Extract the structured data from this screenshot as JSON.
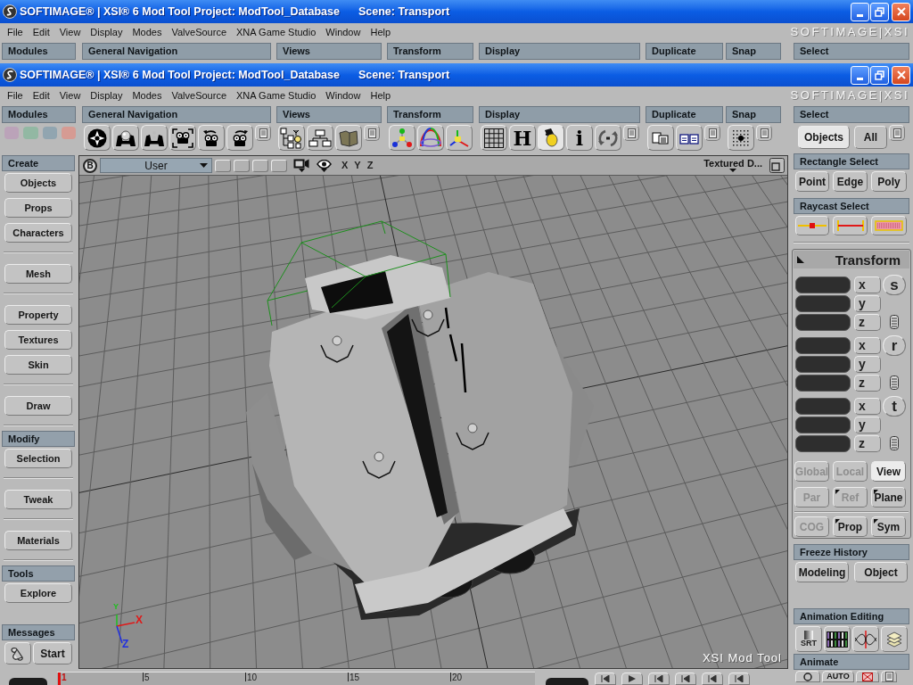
{
  "back_window": {
    "title": "SOFTIMAGE® | XSI® 6 Mod Tool Project: ModTool_Database",
    "scene": "Scene: Transport",
    "menu": [
      "File",
      "Edit",
      "View",
      "Display",
      "Modes",
      "ValveSource",
      "XNA Game Studio",
      "Window",
      "Help"
    ],
    "logo": "SOFTIMAGE|XSI",
    "toolbar_headers": [
      "Modules",
      "General Navigation",
      "Views",
      "Transform",
      "Display",
      "Duplicate",
      "Snap",
      "Select"
    ]
  },
  "window": {
    "title": "SOFTIMAGE® | XSI® 6 Mod Tool Project: ModTool_Database",
    "scene": "Scene: Transport",
    "menu": [
      "File",
      "Edit",
      "View",
      "Display",
      "Modes",
      "ValveSource",
      "XNA Game Studio",
      "Window",
      "Help"
    ],
    "logo": "SOFTIMAGE|XSI",
    "toolbar": [
      {
        "header": "Modules",
        "buttons": [
          {
            "kind": "swatch",
            "color": "#bba3b9"
          },
          {
            "kind": "swatch",
            "color": "#92b8a3"
          },
          {
            "kind": "swatch",
            "color": "#91a5b0"
          },
          {
            "kind": "swatch",
            "color": "#d69b93"
          }
        ]
      },
      {
        "header": "General Navigation",
        "menu_button": true,
        "buttons": [
          {
            "kind": "icon"
          },
          {
            "kind": "icon"
          },
          {
            "kind": "icon"
          },
          {
            "kind": "icon"
          },
          {
            "kind": "icon"
          },
          {
            "kind": "icon"
          }
        ]
      },
      {
        "header": "Views",
        "menu_button": true,
        "buttons": [
          {
            "kind": "icon"
          },
          {
            "kind": "icon"
          },
          {
            "kind": "icon"
          }
        ]
      },
      {
        "header": "Transform",
        "buttons": [
          {
            "kind": "icon"
          },
          {
            "kind": "icon"
          },
          {
            "kind": "icon"
          }
        ]
      },
      {
        "header": "Display",
        "menu_button": true,
        "buttons": [
          {
            "kind": "icon",
            "on": false
          },
          {
            "kind": "glyph",
            "label": "H",
            "on": false
          },
          {
            "kind": "icon",
            "on": true
          },
          {
            "kind": "glyph",
            "label": "i",
            "on": false
          },
          {
            "kind": "icon",
            "on": false
          }
        ]
      },
      {
        "header": "Duplicate",
        "menu_button": true,
        "buttons": [
          {
            "kind": "icon"
          },
          {
            "kind": "icon"
          }
        ]
      },
      {
        "header": "Snap",
        "menu_button": true,
        "buttons": [
          {
            "kind": "icon"
          }
        ]
      },
      {
        "header": "Select",
        "menu_button": true,
        "buttons": [
          {
            "kind": "text",
            "label": "Objects",
            "selected": true
          },
          {
            "kind": "text",
            "label": "All",
            "selected": false
          }
        ]
      }
    ],
    "left_panel": {
      "sections": [
        {
          "header": "Create",
          "groups": [
            [
              "Objects",
              "Props",
              "Characters"
            ],
            [
              "Mesh"
            ],
            [
              "Property",
              "Textures",
              "Skin"
            ],
            [
              "Draw"
            ]
          ]
        },
        {
          "header": "Modify",
          "groups": [
            [
              "Selection"
            ],
            [
              "Tweak"
            ],
            [
              "Materials"
            ]
          ]
        },
        {
          "header": "Tools",
          "groups": [
            [
              "Explore"
            ]
          ]
        }
      ],
      "messages": {
        "header": "Messages",
        "button": "Start"
      }
    },
    "viewport": {
      "camera_letter": "B",
      "view": "User",
      "axes": [
        "X",
        "Y",
        "Z"
      ],
      "display_mode": "Textured D...",
      "gizmo_labels": [
        "Y",
        "X",
        "Z"
      ],
      "caption": "XSI Mod Tool"
    },
    "timeline": {
      "ticks": [
        {
          "label": "1",
          "current": true
        },
        {
          "label": "5",
          "current": false
        },
        {
          "label": "10",
          "current": false
        },
        {
          "label": "15",
          "current": false
        },
        {
          "label": "20",
          "current": false
        }
      ]
    },
    "right_panel": {
      "rectangle_select": {
        "header": "Rectangle Select",
        "buttons": [
          "Point",
          "Edge",
          "Poly"
        ]
      },
      "raycast_select": {
        "header": "Raycast Select"
      },
      "transform": {
        "title": "Transform",
        "groups": [
          {
            "label": "s",
            "axes": [
              "x",
              "y",
              "z"
            ]
          },
          {
            "label": "r",
            "axes": [
              "x",
              "y",
              "z"
            ]
          },
          {
            "label": "t",
            "axes": [
              "x",
              "y",
              "z"
            ]
          }
        ],
        "modes": [
          [
            {
              "label": "Global",
              "selected": false,
              "disabled": true,
              "corner_mark": false
            },
            {
              "label": "Local",
              "selected": false,
              "disabled": true,
              "corner_mark": false
            },
            {
              "label": "View",
              "selected": true,
              "disabled": false,
              "corner_mark": false
            }
          ],
          [
            {
              "label": "Par",
              "selected": false,
              "disabled": true,
              "corner_mark": false
            },
            {
              "label": "Ref",
              "selected": false,
              "disabled": true,
              "corner_mark": true
            },
            {
              "label": "Plane",
              "selected": false,
              "disabled": false,
              "corner_mark": true
            }
          ],
          [
            {
              "label": "COG",
              "selected": false,
              "disabled": true,
              "corner_mark": false
            },
            {
              "label": "Prop",
              "selected": false,
              "disabled": false,
              "corner_mark": true
            },
            {
              "label": "Sym",
              "selected": false,
              "disabled": false,
              "corner_mark": true
            }
          ]
        ]
      },
      "freeze_history": {
        "header": "Freeze History",
        "buttons": [
          "Modeling",
          "Object"
        ]
      },
      "animation_editing": {
        "header": "Animation Editing",
        "srt_label": "SRT"
      },
      "animate": {
        "header": "Animate",
        "auto_label": "AUTO"
      }
    }
  }
}
